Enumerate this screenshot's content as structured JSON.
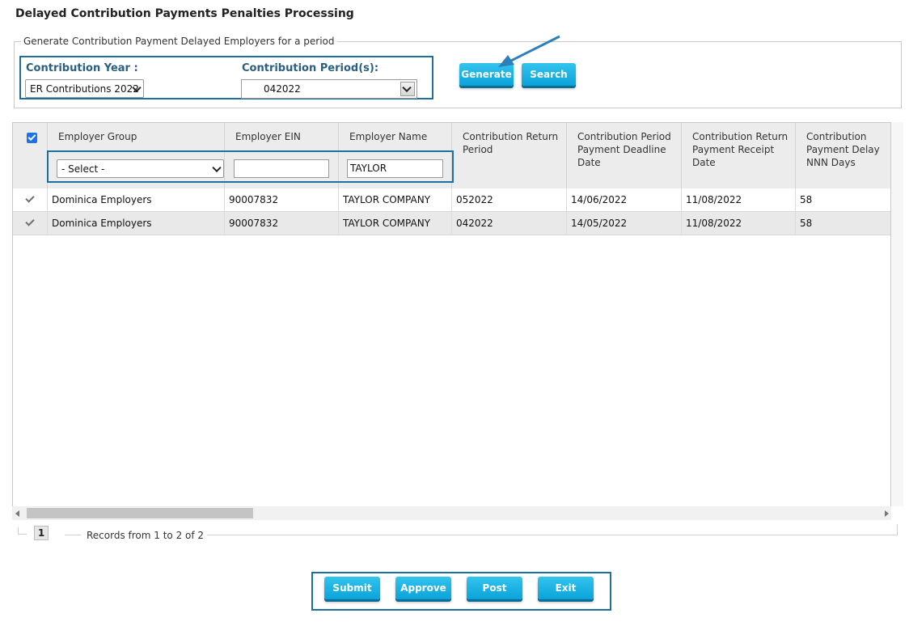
{
  "page_title": "Delayed Contribution Payments Penalties Processing",
  "filter_section": {
    "legend": "Generate Contribution Payment Delayed Employers for a period",
    "contribution_year_label": "Contribution Year :",
    "contribution_year_value": "ER Contributions 2022",
    "contribution_period_label": "Contribution Period(s):",
    "contribution_period_value": "042022",
    "generate_label": "Generate",
    "search_label": "Search"
  },
  "grid": {
    "columns": [
      "Employer Group",
      "Employer EIN",
      "Employer Name",
      "Contribution Return Period",
      "Contribution Period Payment Deadline Date",
      "Contribution Return Payment Receipt Date",
      "Contribution Payment Delay NNN Days"
    ],
    "filters": {
      "employer_group_placeholder": "- Select -",
      "employer_ein_value": "",
      "employer_name_value": "TAYLOR"
    },
    "rows": [
      {
        "checked": true,
        "employer_group": "Dominica Employers",
        "employer_ein": "90007832",
        "employer_name": "TAYLOR COMPANY",
        "return_period": "052022",
        "deadline_date": "14/06/2022",
        "receipt_date": "11/08/2022",
        "delay_days": "58"
      },
      {
        "checked": true,
        "employer_group": "Dominica Employers",
        "employer_ein": "90007832",
        "employer_name": "TAYLOR COMPANY",
        "return_period": "042022",
        "deadline_date": "14/05/2022",
        "receipt_date": "11/08/2022",
        "delay_days": "58"
      }
    ]
  },
  "pager": {
    "current_page": "1",
    "records_text": "Records from 1 to 2 of 2"
  },
  "actions": {
    "submit": "Submit",
    "approve": "Approve",
    "post": "Post",
    "exit": "Exit"
  },
  "colors": {
    "accent": "#0aa3d9",
    "highlight_border": "#1e6fa0",
    "header_bg": "#ececec"
  }
}
